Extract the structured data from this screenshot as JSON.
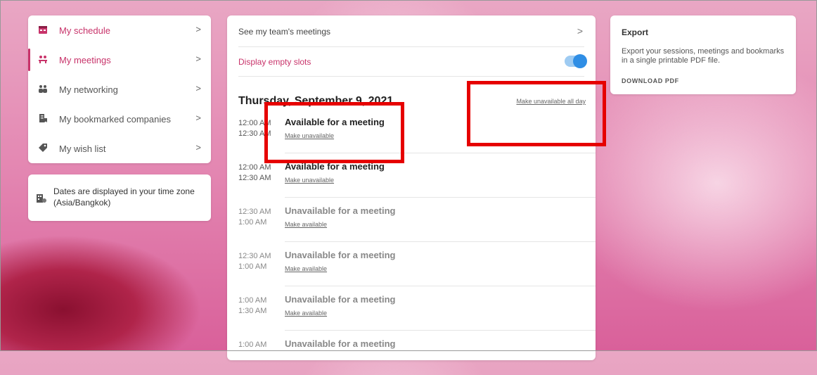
{
  "nav": {
    "items": [
      {
        "label": "My schedule",
        "icon": "calendar-icon"
      },
      {
        "label": "My meetings",
        "icon": "meeting-icon"
      },
      {
        "label": "My networking",
        "icon": "people-icon"
      },
      {
        "label": "My bookmarked companies",
        "icon": "bookmark-building-icon"
      },
      {
        "label": "My wish list",
        "icon": "tag-icon"
      }
    ],
    "chevron": ">"
  },
  "timezone": {
    "text": "Dates are displayed in your time zone (Asia/Bangkok)",
    "icon": "globe-calendar-icon"
  },
  "main": {
    "team_link": "See my team's meetings",
    "chevron": ">",
    "empty_slots_label": "Display empty slots",
    "empty_slots_on": true,
    "date_title": "Thursday, September 9, 2021",
    "all_day_link": "Make unavailable all day",
    "slots": [
      {
        "start": "12:00 AM",
        "end": "12:30 AM",
        "status": "Available for a meeting",
        "action": "Make unavailable"
      },
      {
        "start": "12:00 AM",
        "end": "12:30 AM",
        "status": "Available for a meeting",
        "action": "Make unavailable"
      },
      {
        "start": "12:30 AM",
        "end": "1:00 AM",
        "status": "Unavailable for a meeting",
        "action": "Make available"
      },
      {
        "start": "12:30 AM",
        "end": "1:00 AM",
        "status": "Unavailable for a meeting",
        "action": "Make available"
      },
      {
        "start": "1:00 AM",
        "end": "1:30 AM",
        "status": "Unavailable for a meeting",
        "action": "Make available"
      },
      {
        "start": "1:00 AM",
        "end": "",
        "status": "Unavailable for a meeting",
        "action": ""
      }
    ]
  },
  "export": {
    "title": "Export",
    "description": "Export your sessions, meetings and bookmarks in a single printable PDF file.",
    "download_label": "DOWNLOAD PDF"
  },
  "colors": {
    "accent": "#c8336a",
    "toggle": "#2f8ee5",
    "highlight": "#e60000"
  }
}
